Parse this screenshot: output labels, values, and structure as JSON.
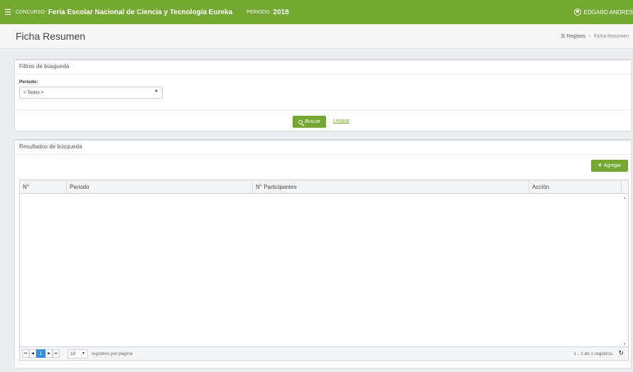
{
  "topbar": {
    "menu_icon": "☰",
    "concurso_label": "CONCURSO:",
    "concurso_name": "Feria Escolar Nacional de Ciencia y Tecnología Eureka",
    "periodo_label": "PERIODO:",
    "periodo_value": "2018",
    "user_name": "EDGARD ANDRES"
  },
  "header": {
    "title": "Ficha Resumen",
    "breadcrumb": {
      "icon": "☰",
      "root": "Registro",
      "sep": "›",
      "current": "Ficha Resumen"
    }
  },
  "filters": {
    "title": "Filtros de búsqueda",
    "periodo_label": "Periodo:",
    "periodo_selected": "< Todos >",
    "buscar_label": "Buscar",
    "limpiar_label": "Limpiar"
  },
  "results": {
    "title": "Resultados de búsqueda",
    "agregar_label": "Agregar",
    "columns": [
      "N°",
      "Periodo",
      "N° Participantes",
      "Acción"
    ],
    "rows": []
  },
  "pager": {
    "first": "⏮",
    "prev": "◀",
    "current_page": "1",
    "next": "▶",
    "last": "⏭",
    "page_size": "10",
    "per_page_label": "registros por página",
    "info": "1 - 1 de 1 registros",
    "refresh_icon": "↻"
  },
  "colors": {
    "accent": "#75a832",
    "page_active": "#3b8ed8"
  }
}
